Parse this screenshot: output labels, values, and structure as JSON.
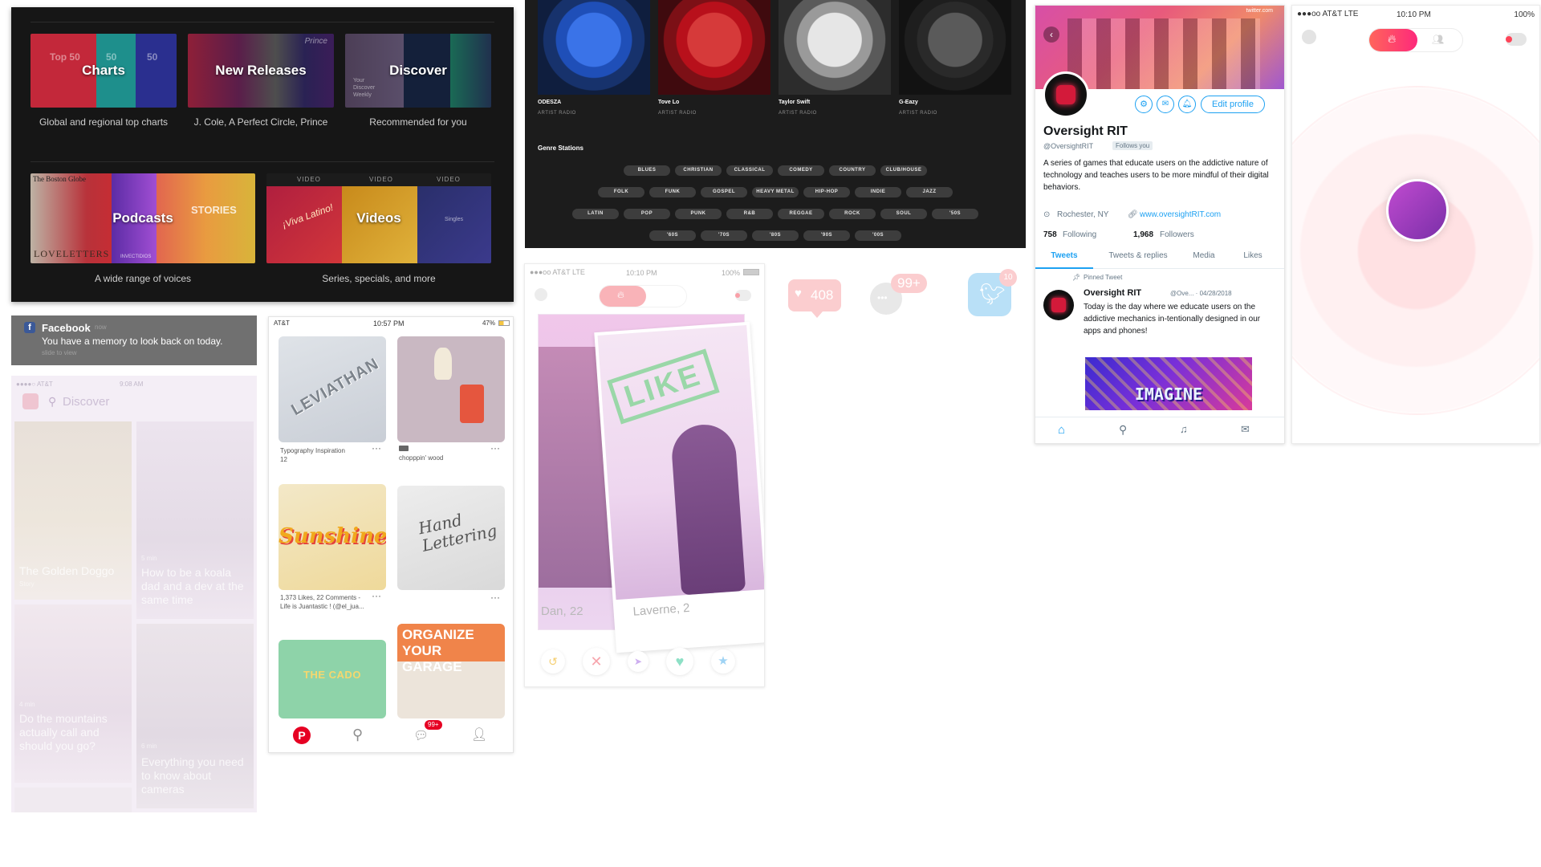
{
  "spotify_browse": {
    "tiles": [
      {
        "title": "Charts",
        "subtitle": "Global and regional top charts",
        "color": "#c3283a"
      },
      {
        "title": "New Releases",
        "subtitle": "J. Cole, A Perfect Circle, Prince",
        "color": "#8e1f38"
      },
      {
        "title": "Discover",
        "subtitle": "Recommended for you",
        "color": "#2d3a6a"
      },
      {
        "title": "Podcasts",
        "subtitle": "A wide range of voices",
        "color": "#7a3ba8"
      },
      {
        "title": "Videos",
        "subtitle": "Series, specials, and more",
        "color": "#c56a1d"
      }
    ],
    "chart_art_labels": [
      "Top 50",
      "50",
      "50"
    ],
    "discover_art_text": "Your Discover Weekly",
    "new_releases_art_text": "Prince",
    "podcast_art_texts": [
      "The Boston Globe",
      "STORIES",
      "LOVELETTERS",
      "INVECTIDIOS"
    ],
    "video_label": "VIDEO",
    "video_art_texts": [
      "¡Viva Latino!",
      "Singles"
    ]
  },
  "spotify_radio": {
    "artists": [
      {
        "name": "ODESZA",
        "sub": "ARTIST RADIO",
        "color": "#1f4fb8"
      },
      {
        "name": "Tove Lo",
        "sub": "ARTIST RADIO",
        "color": "#b8101b"
      },
      {
        "name": "Taylor Swift",
        "sub": "ARTIST RADIO",
        "color": "#9a9a9a"
      },
      {
        "name": "G-Eazy",
        "sub": "ARTIST RADIO",
        "color": "#2a2a2a"
      }
    ],
    "genre_heading": "Genre Stations",
    "genres": [
      [
        "BLUES",
        "CHRISTIAN",
        "CLASSICAL",
        "COMEDY",
        "COUNTRY",
        "CLUB/HOUSE"
      ],
      [
        "FOLK",
        "FUNK",
        "GOSPEL",
        "HEAVY METAL",
        "HIP-HOP",
        "INDIE",
        "JAZZ"
      ],
      [
        "LATIN",
        "POP",
        "PUNK",
        "R&B",
        "REGGAE",
        "ROCK",
        "SOUL",
        "'50S"
      ],
      [
        "'60S",
        "'70S",
        "'80S",
        "'90S",
        "'00S"
      ]
    ]
  },
  "twitter": {
    "url_text": "twitter.com",
    "name": "Oversight RIT",
    "handle": "@OversightRIT",
    "follows_you": "Follows you",
    "edit_profile": "Edit profile",
    "bio": "A series of games that educate users on the addictive nature of technology and teaches users to be more mindful of their digital behaviors.",
    "location": "Rochester, NY",
    "website": "www.oversightRIT.com",
    "following_count": "758",
    "following_label": "Following",
    "followers_count": "1,968",
    "followers_label": "Followers",
    "tabs": [
      "Tweets",
      "Tweets & replies",
      "Media",
      "Likes"
    ],
    "pinned_label": "Pinned Tweet",
    "tweet_name": "Oversight RIT",
    "tweet_meta": "@Ove... · 04/28/2018",
    "tweet_text": "Today is the day where we educate users on the addictive mechanics in-tentionally designed in our apps and phones!",
    "image_text": "IMAGINE",
    "accent": "#1da1f2"
  },
  "tinder_radar": {
    "carrier": "●●●oo AT&T LTE",
    "time": "10:10 PM",
    "battery": "100%",
    "accent": "#ff5864"
  },
  "facebook_notif": {
    "app": "Facebook",
    "when": "now",
    "message": "You have a memory to look back on today.",
    "action": "slide to view"
  },
  "facebook_ghost": {
    "status_left": "●●●●○ AT&T",
    "status_time": "9:08 AM",
    "search_label": "Discover",
    "cards": [
      {
        "title": "The Golden Doggo",
        "meta": "Story"
      },
      {
        "title": "How to be a koala dad and a dev at the same time",
        "meta": "5 min"
      },
      {
        "title": "Do the mountains actually call and should you go?",
        "meta": "4 min"
      },
      {
        "title": "Everything you need to know about cameras",
        "meta": "6 min"
      }
    ]
  },
  "pinterest": {
    "carrier": "AT&T",
    "time": "10:57 PM",
    "battery": "47%",
    "pins": [
      {
        "caption": "Typography Inspiration",
        "sub": "12",
        "art_text": "LEVIATHAN"
      },
      {
        "caption": "chopppin' wood",
        "sub": "",
        "art_text": ""
      },
      {
        "caption": "1,373 Likes, 22 Comments - Life is Juantastic ! (@el_jua...",
        "sub": "",
        "art_text": "Sunshine"
      },
      {
        "caption": "",
        "sub": "",
        "art_text": "Hand Lettering"
      },
      {
        "caption": "",
        "sub": "",
        "art_text": "THE CADO"
      },
      {
        "caption": "",
        "sub": "",
        "art_text": "ORGANIZE YOUR GARAGE"
      }
    ],
    "badge": "99+",
    "brand": "#e60023"
  },
  "tinder_cards": {
    "carrier": "●●●oo AT&T LTE",
    "time": "10:10 PM",
    "battery": "100%",
    "back_card_name": "Dan, 22",
    "front_card_name": "Laverne, 2",
    "stamp": "LIKE"
  },
  "notif_icons": {
    "likes": "408",
    "messages": "99+",
    "twitter_badge": "10"
  }
}
